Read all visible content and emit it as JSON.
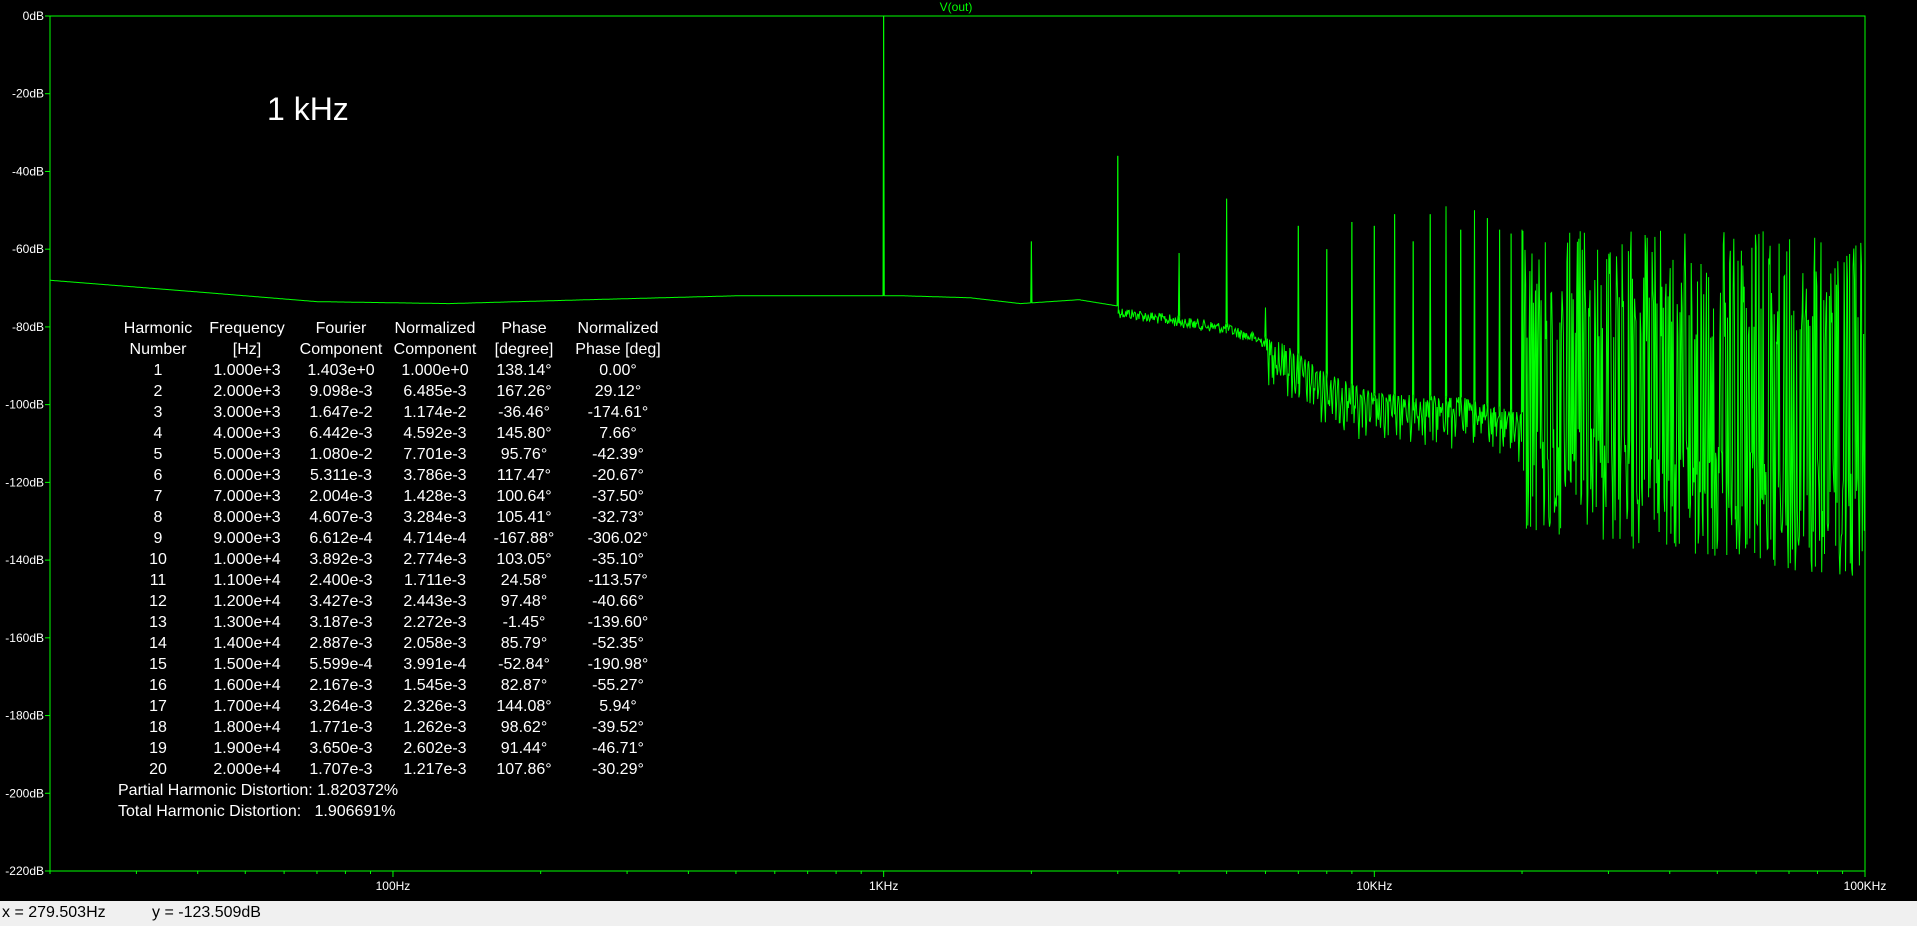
{
  "plot": {
    "trace_name": "V(out)",
    "trace_color": "#00ff00",
    "background": "#000000",
    "frame_color": "#00ff00",
    "annotation": "1 kHz"
  },
  "chart_data": {
    "type": "line",
    "x_scale": "log",
    "xlim_hz": [
      20,
      100000
    ],
    "ylim_db": [
      -220,
      0
    ],
    "y_ticks": [
      {
        "v": 0,
        "label": "0dB"
      },
      {
        "v": -20,
        "label": "-20dB"
      },
      {
        "v": -40,
        "label": "-40dB"
      },
      {
        "v": -60,
        "label": "-60dB"
      },
      {
        "v": -80,
        "label": "-80dB"
      },
      {
        "v": -100,
        "label": "-100dB"
      },
      {
        "v": -120,
        "label": "-120dB"
      },
      {
        "v": -140,
        "label": "-140dB"
      },
      {
        "v": -160,
        "label": "-160dB"
      },
      {
        "v": -180,
        "label": "-180dB"
      },
      {
        "v": -200,
        "label": "-200dB"
      },
      {
        "v": -220,
        "label": "-220dB"
      }
    ],
    "x_ticks": [
      {
        "v": 100,
        "label": "100Hz"
      },
      {
        "v": 1000,
        "label": "1KHz"
      },
      {
        "v": 10000,
        "label": "10KHz"
      },
      {
        "v": 100000,
        "label": "100KHz"
      }
    ],
    "noise_floor": [
      [
        20,
        -68
      ],
      [
        40,
        -71
      ],
      [
        70,
        -73.5
      ],
      [
        130,
        -74
      ],
      [
        250,
        -73
      ],
      [
        500,
        -72
      ],
      [
        900,
        -72
      ],
      [
        1100,
        -72
      ],
      [
        1500,
        -72.5
      ],
      [
        1900,
        -74
      ],
      [
        2500,
        -73
      ],
      [
        3500,
        -76
      ],
      [
        5000,
        -79
      ],
      [
        6500,
        -84
      ],
      [
        8000,
        -92
      ],
      [
        10000,
        -97
      ],
      [
        15000,
        -98
      ],
      [
        25000,
        -105
      ],
      [
        50000,
        -110
      ],
      [
        100000,
        -115
      ]
    ],
    "peaks": [
      {
        "f": 1000,
        "db": 0
      },
      {
        "f": 2000,
        "db": -58
      },
      {
        "f": 3000,
        "db": -36
      },
      {
        "f": 4000,
        "db": -61
      },
      {
        "f": 5000,
        "db": -47
      },
      {
        "f": 6000,
        "db": -75
      },
      {
        "f": 7000,
        "db": -54
      },
      {
        "f": 8000,
        "db": -60
      },
      {
        "f": 9000,
        "db": -53
      },
      {
        "f": 10000,
        "db": -54
      },
      {
        "f": 11000,
        "db": -51
      },
      {
        "f": 12000,
        "db": -58
      },
      {
        "f": 13000,
        "db": -51
      },
      {
        "f": 14000,
        "db": -49
      },
      {
        "f": 15000,
        "db": -55
      },
      {
        "f": 16000,
        "db": -50
      },
      {
        "f": 17000,
        "db": -52
      },
      {
        "f": 18000,
        "db": -55
      },
      {
        "f": 19000,
        "db": -56
      },
      {
        "f": 20000,
        "db": -55
      }
    ],
    "dense_region_hz": [
      20000,
      100000
    ]
  },
  "fourier": {
    "headers": [
      [
        "Harmonic",
        "Number"
      ],
      [
        "Frequency",
        "[Hz]"
      ],
      [
        "Fourier",
        "Component"
      ],
      [
        "Normalized",
        "Component"
      ],
      [
        "Phase",
        "[degree]"
      ],
      [
        "Normalized",
        "Phase [deg]"
      ]
    ],
    "rows": [
      [
        "1",
        "1.000e+3",
        "1.403e+0",
        "1.000e+0",
        "138.14°",
        "0.00°"
      ],
      [
        "2",
        "2.000e+3",
        "9.098e-3",
        "6.485e-3",
        "167.26°",
        "29.12°"
      ],
      [
        "3",
        "3.000e+3",
        "1.647e-2",
        "1.174e-2",
        "-36.46°",
        "-174.61°"
      ],
      [
        "4",
        "4.000e+3",
        "6.442e-3",
        "4.592e-3",
        "145.80°",
        "7.66°"
      ],
      [
        "5",
        "5.000e+3",
        "1.080e-2",
        "7.701e-3",
        "95.76°",
        "-42.39°"
      ],
      [
        "6",
        "6.000e+3",
        "5.311e-3",
        "3.786e-3",
        "117.47°",
        "-20.67°"
      ],
      [
        "7",
        "7.000e+3",
        "2.004e-3",
        "1.428e-3",
        "100.64°",
        "-37.50°"
      ],
      [
        "8",
        "8.000e+3",
        "4.607e-3",
        "3.284e-3",
        "105.41°",
        "-32.73°"
      ],
      [
        "9",
        "9.000e+3",
        "6.612e-4",
        "4.714e-4",
        "-167.88°",
        "-306.02°"
      ],
      [
        "10",
        "1.000e+4",
        "3.892e-3",
        "2.774e-3",
        "103.05°",
        "-35.10°"
      ],
      [
        "11",
        "1.100e+4",
        "2.400e-3",
        "1.711e-3",
        "24.58°",
        "-113.57°"
      ],
      [
        "12",
        "1.200e+4",
        "3.427e-3",
        "2.443e-3",
        "97.48°",
        "-40.66°"
      ],
      [
        "13",
        "1.300e+4",
        "3.187e-3",
        "2.272e-3",
        "-1.45°",
        "-139.60°"
      ],
      [
        "14",
        "1.400e+4",
        "2.887e-3",
        "2.058e-3",
        "85.79°",
        "-52.35°"
      ],
      [
        "15",
        "1.500e+4",
        "5.599e-4",
        "3.991e-4",
        "-52.84°",
        "-190.98°"
      ],
      [
        "16",
        "1.600e+4",
        "2.167e-3",
        "1.545e-3",
        "82.87°",
        "-55.27°"
      ],
      [
        "17",
        "1.700e+4",
        "3.264e-3",
        "2.326e-3",
        "144.08°",
        "5.94°"
      ],
      [
        "18",
        "1.800e+4",
        "1.771e-3",
        "1.262e-3",
        "98.62°",
        "-39.52°"
      ],
      [
        "19",
        "1.900e+4",
        "3.650e-3",
        "2.602e-3",
        "91.44°",
        "-46.71°"
      ],
      [
        "20",
        "2.000e+4",
        "1.707e-3",
        "1.217e-3",
        "107.86°",
        "-30.29°"
      ]
    ],
    "partial_thd": "Partial Harmonic Distortion: 1.820372%",
    "total_thd": "Total Harmonic Distortion:   1.906691%"
  },
  "statusbar": {
    "x_readout": "x = 279.503Hz",
    "y_readout": "y = -123.509dB"
  }
}
